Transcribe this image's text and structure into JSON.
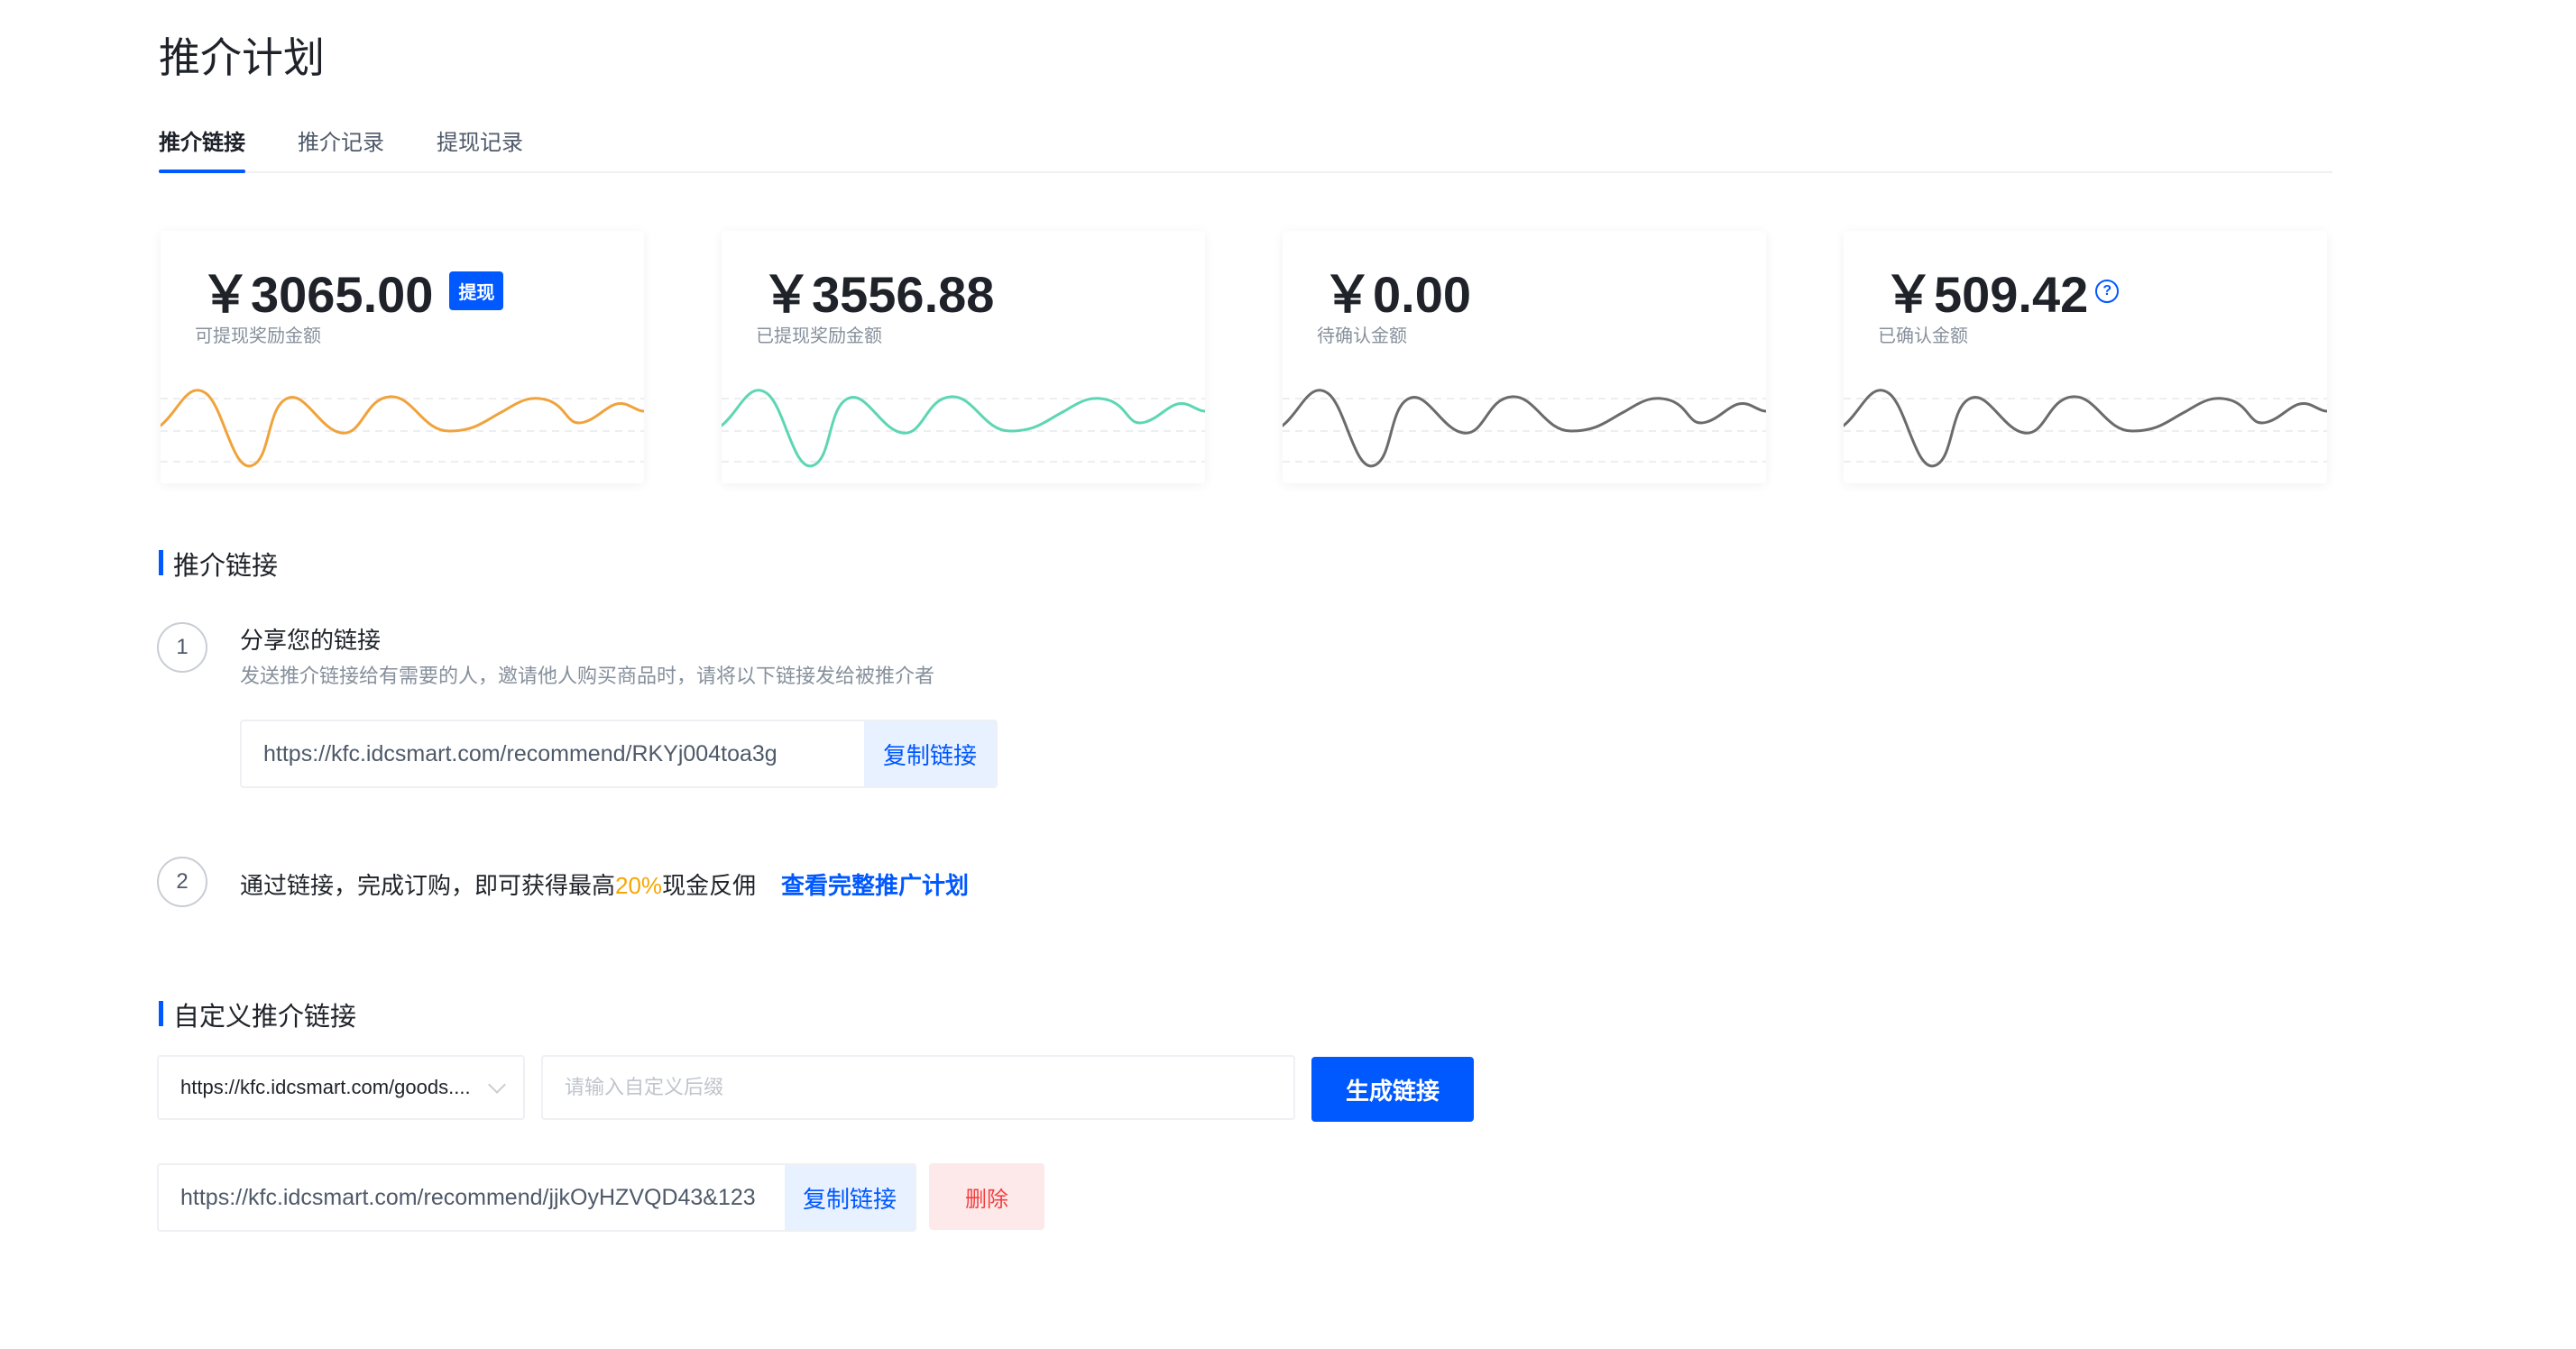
{
  "page": {
    "title": "推介计划"
  },
  "tabs": [
    {
      "label": "推介链接",
      "active": true
    },
    {
      "label": "推介记录",
      "active": false
    },
    {
      "label": "提现记录",
      "active": false
    }
  ],
  "stats": [
    {
      "amount": "￥3065.00",
      "label": "可提现奖励金额",
      "badge": "提现",
      "line_color": "#f0a33c"
    },
    {
      "amount": "￥3556.88",
      "label": "已提现奖励金额",
      "line_color": "#5dd6b3"
    },
    {
      "amount": "￥0.00",
      "label": "待确认金额",
      "line_color": "#6b6b6b"
    },
    {
      "amount": "￥509.42",
      "label": "已确认金额",
      "help_icon": "question-circle-icon",
      "help_glyph": "?",
      "line_color": "#6b6b6b"
    }
  ],
  "referral": {
    "section_title": "推介链接",
    "step1": {
      "num": "1",
      "title": "分享您的链接",
      "desc": "发送推介链接给有需要的人，邀请他人购买商品时，请将以下链接发给被推介者",
      "link": "https://kfc.idcsmart.com/recommend/RKYj004toa3g",
      "copy_label": "复制链接"
    },
    "step2": {
      "num": "2",
      "text_before": "通过链接，完成订购，即可获得最高",
      "highlight": "20%",
      "text_after": "现金反佣",
      "plan_link": "查看完整推广计划"
    }
  },
  "custom": {
    "section_title": "自定义推介链接",
    "select_value": "https://kfc.idcsmart.com/goods....",
    "suffix_placeholder": "请输入自定义后缀",
    "generate_label": "生成链接",
    "generated_link": "https://kfc.idcsmart.com/recommend/jjkOyHZVQD43&123",
    "copy_label": "复制链接",
    "delete_label": "删除"
  },
  "colors": {
    "primary": "#0058ff",
    "danger": "#f53f3f",
    "highlight": "#f7a600"
  }
}
